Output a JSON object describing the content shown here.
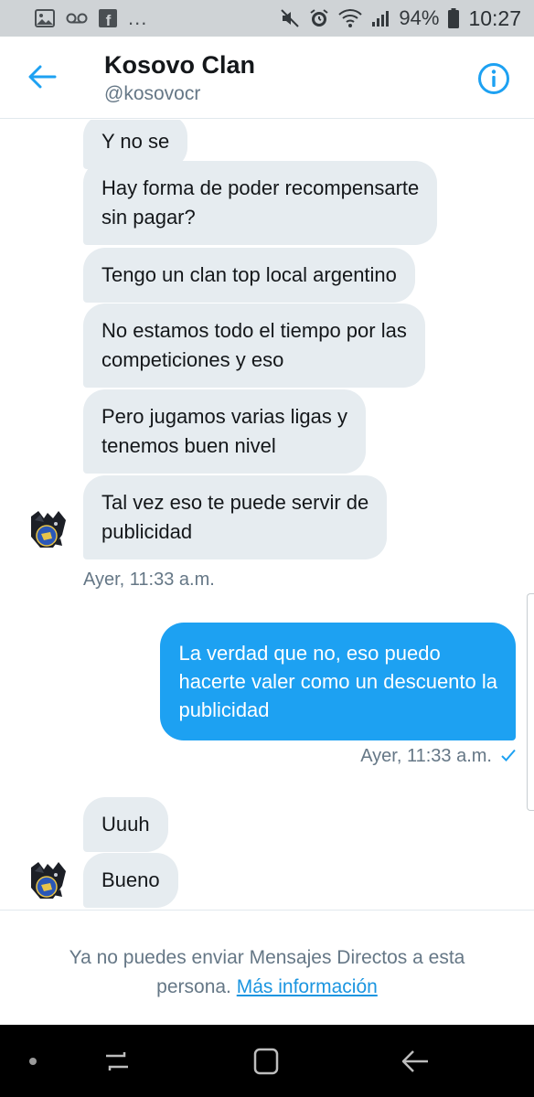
{
  "status_bar": {
    "left_icons": [
      "image-icon",
      "voicemail-icon",
      "facebook-icon",
      "more-dots"
    ],
    "facebook_glyph": "f",
    "more": "...",
    "battery_pct": "94%",
    "time": "10:27"
  },
  "header": {
    "title": "Kosovo Clan",
    "handle": "@kosovocr"
  },
  "messages": {
    "in1": "Y no se",
    "in2_l1": "Hay forma de poder recompensarte",
    "in2_l2": "sin pagar?",
    "in3": "Tengo un clan top local argentino",
    "in4_l1": "No estamos todo el tiempo por las",
    "in4_l2": "competiciones y eso",
    "in5_l1": "Pero jugamos varias ligas y",
    "in5_l2": "tenemos buen nivel",
    "in6_l1": "Tal vez eso te puede servir de",
    "in6_l2": "publicidad",
    "ts1": "Ayer, 11:33 a.m.",
    "out1_l1": "La verdad que no,  eso puedo",
    "out1_l2": "hacerte valer como un descuento la",
    "out1_l3": "publicidad",
    "ts2": "Ayer, 11:33 a.m.",
    "in7": "Uuuh",
    "in8": "Bueno"
  },
  "footer": {
    "notice_l1": "Ya no puedes enviar Mensajes Directos a esta",
    "notice_l2": "persona.",
    "link": "Más información"
  },
  "colors": {
    "accent": "#1da1f2",
    "bubble_in": "#e6ecf0",
    "text_primary": "#14171a",
    "text_secondary": "#657786"
  }
}
